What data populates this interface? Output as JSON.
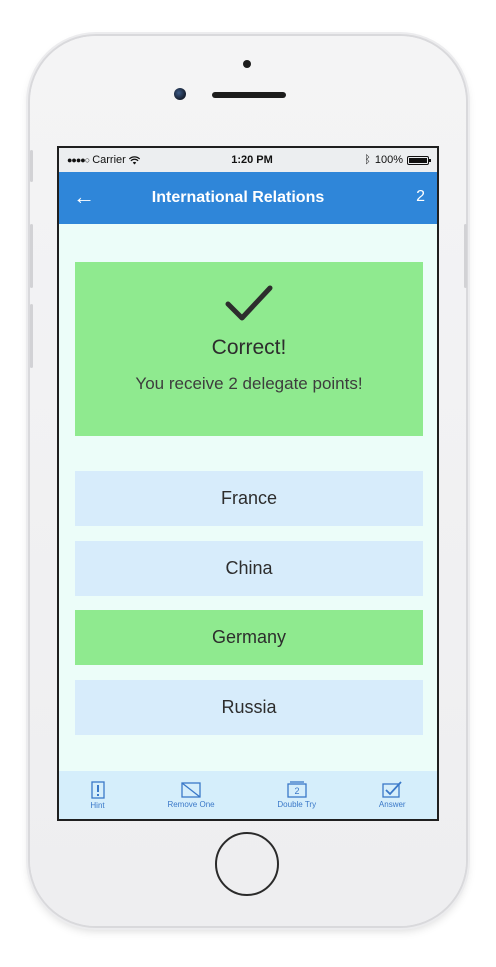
{
  "status_bar": {
    "carrier": "Carrier",
    "time": "1:20 PM",
    "battery": "100%",
    "battery_level": 1.0
  },
  "nav": {
    "title": "International Relations",
    "count": "2",
    "back_icon": "arrow-left-icon",
    "color": "#2f86d9"
  },
  "result": {
    "title": "Correct!",
    "message": "You receive 2 delegate points!",
    "icon": "checkmark-icon",
    "color": "#8fea8f"
  },
  "options": [
    {
      "label": "France",
      "state": "default"
    },
    {
      "label": "China",
      "state": "default"
    },
    {
      "label": "Germany",
      "state": "correct"
    },
    {
      "label": "Russia",
      "state": "default"
    }
  ],
  "toolbar": {
    "hint": "Hint",
    "remove_one": "Remove One",
    "double_try": "Double Try",
    "double_try_badge": "2",
    "answer": "Answer"
  }
}
